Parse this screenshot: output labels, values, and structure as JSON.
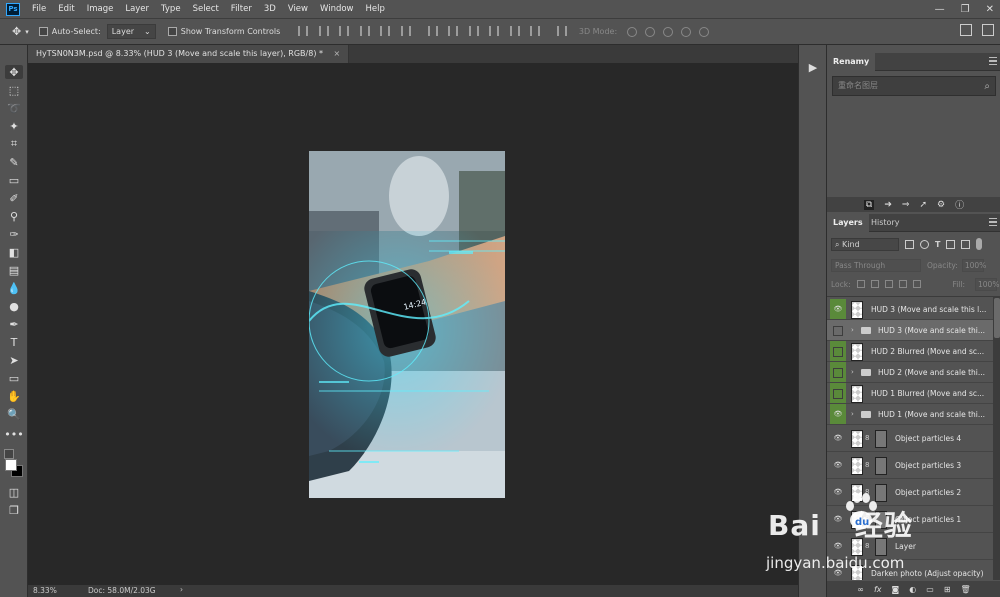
{
  "menubar": {
    "logo": "Ps",
    "items": [
      "File",
      "Edit",
      "Image",
      "Layer",
      "Type",
      "Select",
      "Filter",
      "3D",
      "View",
      "Window",
      "Help"
    ]
  },
  "options": {
    "auto_select_label": "Auto-Select:",
    "auto_select_value": "Layer",
    "show_transform_label": "Show Transform Controls",
    "mode_3d_label": "3D Mode:"
  },
  "document": {
    "tab_title": "HyTSN0N3M.psd @ 8.33% (HUD 3 (Move and scale this layer), RGB/8) *",
    "close_symbol": "×"
  },
  "statusbar": {
    "zoom": "8.33%",
    "doc_size": "Doc: 58.0M/2.03G",
    "arrow": "›"
  },
  "renamy": {
    "title": "Renamy",
    "search_placeholder": "重命名图层"
  },
  "layers_panel": {
    "tabs": [
      "Layers",
      "History"
    ],
    "filter_kind": "Kind",
    "blend_mode": "Pass Through",
    "opacity_label": "Opacity:",
    "opacity_value": "100%",
    "lock_label": "Lock:",
    "fill_label": "Fill:",
    "fill_value": "100%",
    "layers": [
      {
        "name": "HUD 3 (Move and scale this l...",
        "visible": true,
        "type": "smart",
        "highlight": true
      },
      {
        "name": "HUD 3 (Move and scale thi...",
        "visible": false,
        "type": "group",
        "selected": true
      },
      {
        "name": "HUD 2 Blurred (Move and sc...",
        "visible": false,
        "type": "smart",
        "highlight": true
      },
      {
        "name": "HUD 2 (Move and scale thi...",
        "visible": false,
        "type": "group",
        "highlight": true
      },
      {
        "name": "HUD 1 Blurred (Move and sc...",
        "visible": false,
        "type": "smart",
        "highlight": true
      },
      {
        "name": "HUD 1 (Move and scale thi...",
        "visible": true,
        "type": "group",
        "highlight": true
      },
      {
        "name": "Object particles 4",
        "visible": true,
        "type": "masked"
      },
      {
        "name": "Object particles 3",
        "visible": true,
        "type": "masked"
      },
      {
        "name": "Object particles 2",
        "visible": true,
        "type": "masked"
      },
      {
        "name": "Object particles 1",
        "visible": true,
        "type": "masked"
      },
      {
        "name": "Layer",
        "visible": true,
        "type": "masked"
      },
      {
        "name": "Darken photo (Adjust opacity)",
        "visible": true,
        "type": "smart"
      }
    ]
  },
  "watermark": {
    "brand": "Bai",
    "brand2": "经验",
    "url": "jingyan.baidu.com"
  },
  "colors": {
    "accent_green": "#5a8a3a",
    "ps_blue": "#31a8ff"
  }
}
